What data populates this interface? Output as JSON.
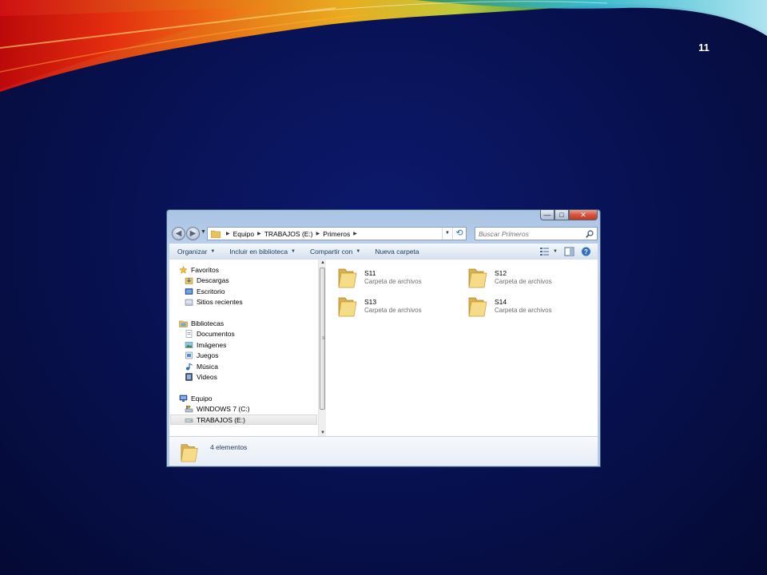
{
  "slide": {
    "number": "11"
  },
  "window": {
    "caption_buttons": {
      "minimize": "—",
      "maximize": "□",
      "close": "✕"
    },
    "address": {
      "crumbs": [
        "Equipo",
        "TRABAJOS (E:)",
        "Primeros"
      ]
    },
    "search": {
      "placeholder": "Buscar Primeros"
    },
    "command_bar": {
      "organize": "Organizar",
      "include_in_library": "Incluir en biblioteca",
      "share_with": "Compartir con",
      "new_folder": "Nueva carpeta"
    },
    "nav_pane": {
      "favorites": {
        "label": "Favoritos",
        "items": [
          "Descargas",
          "Escritorio",
          "Sitios recientes"
        ]
      },
      "libraries": {
        "label": "Bibliotecas",
        "items": [
          "Documentos",
          "Imágenes",
          "Juegos",
          "Música",
          "Videos"
        ]
      },
      "computer": {
        "label": "Equipo",
        "items": [
          "WINDOWS 7 (C:)",
          "TRABAJOS (E:)"
        ],
        "selected": "TRABAJOS (E:)"
      }
    },
    "items": [
      {
        "name": "S11",
        "type": "Carpeta de archivos"
      },
      {
        "name": "S12",
        "type": "Carpeta de archivos"
      },
      {
        "name": "S13",
        "type": "Carpeta de archivos"
      },
      {
        "name": "S14",
        "type": "Carpeta de archivos"
      }
    ],
    "details": {
      "count_text": "4 elementos"
    }
  },
  "colors": {
    "background": "#081254",
    "accent_orange": "#f07a14",
    "accent_red": "#e01010",
    "accent_cyan": "#5fd3ea",
    "folder_yellow": "#f5d67a"
  }
}
